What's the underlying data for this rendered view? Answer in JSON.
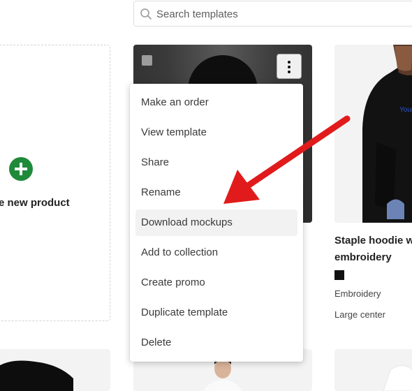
{
  "search": {
    "placeholder": "Search templates",
    "icon": "search-icon"
  },
  "create_card": {
    "label": "e new product",
    "icon": "plus-icon",
    "accent": "#1f8a3a"
  },
  "template_menu": {
    "items": [
      {
        "label": "Make an order"
      },
      {
        "label": "View template"
      },
      {
        "label": "Share"
      },
      {
        "label": "Rename"
      },
      {
        "label": "Download mockups",
        "highlighted": true
      },
      {
        "label": "Add to collection"
      },
      {
        "label": "Create promo"
      },
      {
        "label": "Duplicate template"
      },
      {
        "label": "Delete"
      }
    ]
  },
  "product_card": {
    "title": "Staple hoodie w embroidery",
    "print_text": "Your",
    "color_swatch": "#111111",
    "technique": "Embroidery",
    "placement": "Large center"
  },
  "annotation": {
    "arrow_color": "#e11b1b"
  }
}
